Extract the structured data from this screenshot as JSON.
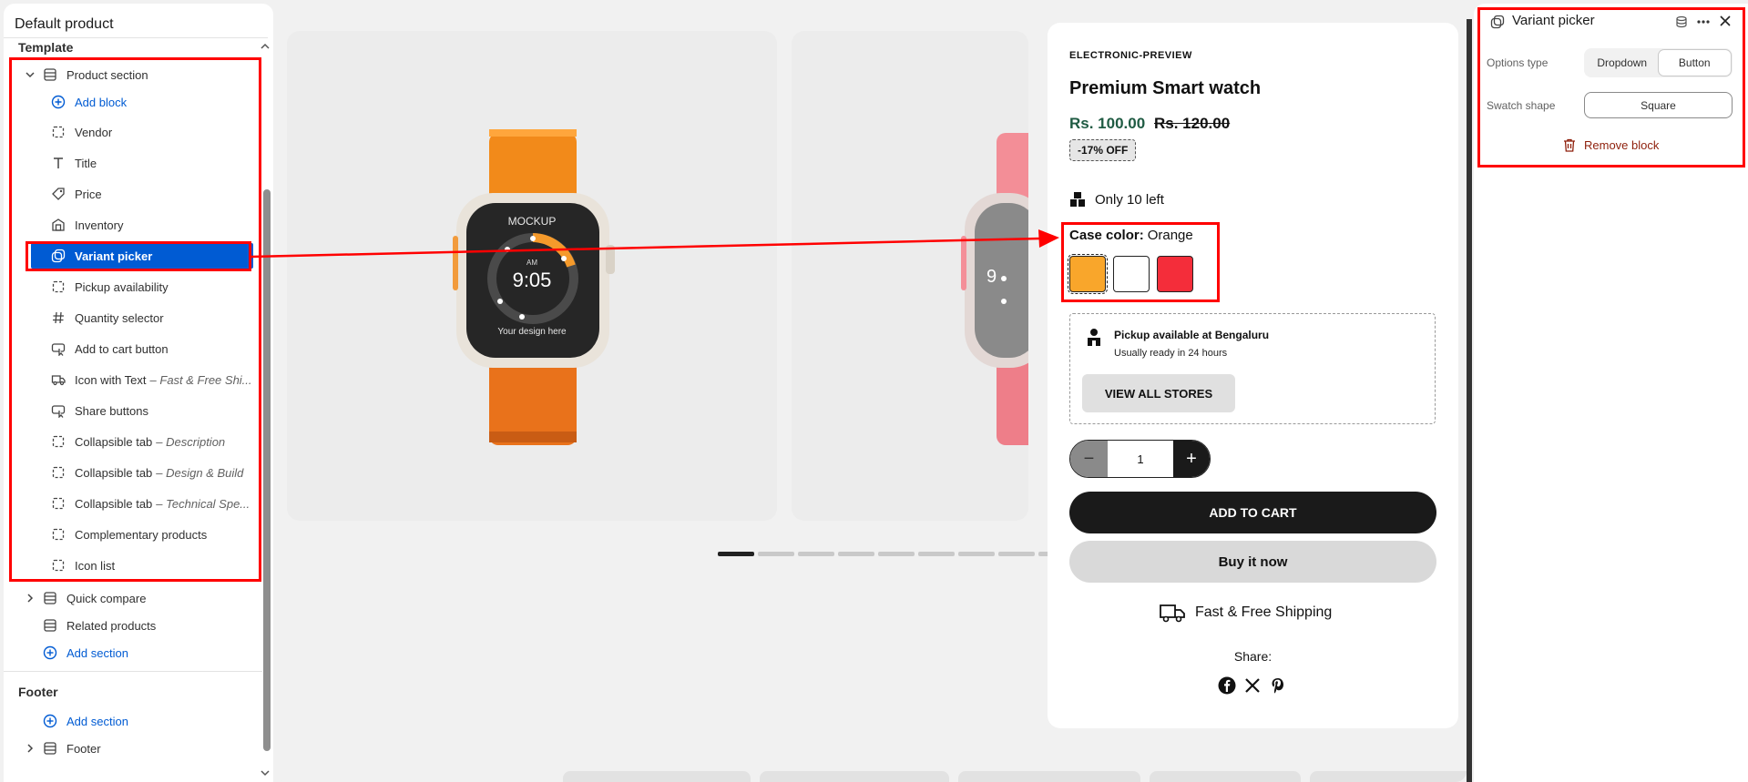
{
  "left_panel": {
    "title": "Default product",
    "template_heading": "Template",
    "product_section_label": "Product section",
    "add_block_label": "Add block",
    "blocks": [
      {
        "label": "Vendor",
        "sub": "",
        "icon": "dashed-square-icon"
      },
      {
        "label": "Title",
        "sub": "",
        "icon": "text-t-icon"
      },
      {
        "label": "Price",
        "sub": "",
        "icon": "price-tag-icon"
      },
      {
        "label": "Inventory",
        "sub": "",
        "icon": "inventory-icon"
      },
      {
        "label": "Variant picker",
        "sub": "",
        "icon": "variant-icon"
      },
      {
        "label": "Pickup availability",
        "sub": "",
        "icon": "dashed-square-icon"
      },
      {
        "label": "Quantity selector",
        "sub": "",
        "icon": "hash-icon"
      },
      {
        "label": "Add to cart button",
        "sub": "",
        "icon": "button-cursor-icon"
      },
      {
        "label": "Icon with Text",
        "sub": "– Fast & Free Shi...",
        "icon": "truck-icon"
      },
      {
        "label": "Share buttons",
        "sub": "",
        "icon": "button-cursor-icon"
      },
      {
        "label": "Collapsible tab",
        "sub": "– Description",
        "icon": "dashed-square-icon"
      },
      {
        "label": "Collapsible tab",
        "sub": "– Design & Build",
        "icon": "dashed-square-icon"
      },
      {
        "label": "Collapsible tab",
        "sub": "– Technical Spe...",
        "icon": "dashed-square-icon"
      },
      {
        "label": "Complementary products",
        "sub": "",
        "icon": "dashed-square-icon"
      },
      {
        "label": "Icon list",
        "sub": "",
        "icon": "dashed-square-icon"
      }
    ],
    "quick_compare_label": "Quick compare",
    "related_products_label": "Related products",
    "add_section_label": "Add section",
    "footer_heading": "Footer",
    "footer_add_section_label": "Add section",
    "footer_label": "Footer"
  },
  "preview": {
    "watch": {
      "brand": "MOCKUP",
      "ampm": "AM",
      "time": "9:05",
      "tagline": "Your design here",
      "side_time": "9"
    },
    "slide_count": 11,
    "active_slide": 0
  },
  "product": {
    "vendor": "ELECTRONIC-PREVIEW",
    "title": "Premium Smart watch",
    "price": "Rs. 100.00",
    "compare_price": "Rs. 120.00",
    "discount_badge": "-17% OFF",
    "stock_text": "Only 10 left",
    "case_color_label": "Case color:",
    "case_color_value": "Orange",
    "swatches": [
      {
        "name": "Orange",
        "color": "#f9a62b"
      },
      {
        "name": "White",
        "color": "#ffffff"
      },
      {
        "name": "Red",
        "color": "#f42d3a"
      }
    ],
    "pickup_title": "Pickup available at Bengaluru",
    "pickup_sub": "Usually ready in 24 hours",
    "view_stores_label": "VIEW ALL STORES",
    "quantity": "1",
    "add_to_cart_label": "ADD TO CART",
    "buy_now_label": "Buy it now",
    "shipping_text": "Fast & Free Shipping",
    "share_label": "Share:"
  },
  "right_panel": {
    "title": "Variant picker",
    "options_type_label": "Options type",
    "options": [
      "Dropdown",
      "Button"
    ],
    "selected_option": "Button",
    "swatch_shape_label": "Swatch shape",
    "swatch_shape_value": "Square",
    "remove_label": "Remove block"
  },
  "colors": {
    "accent_blue": "#005bd3",
    "selected_row": "#005bd3",
    "annotation_red": "#ff0000",
    "price_green": "#1f5b43",
    "remove_red": "#8e1f0b"
  }
}
